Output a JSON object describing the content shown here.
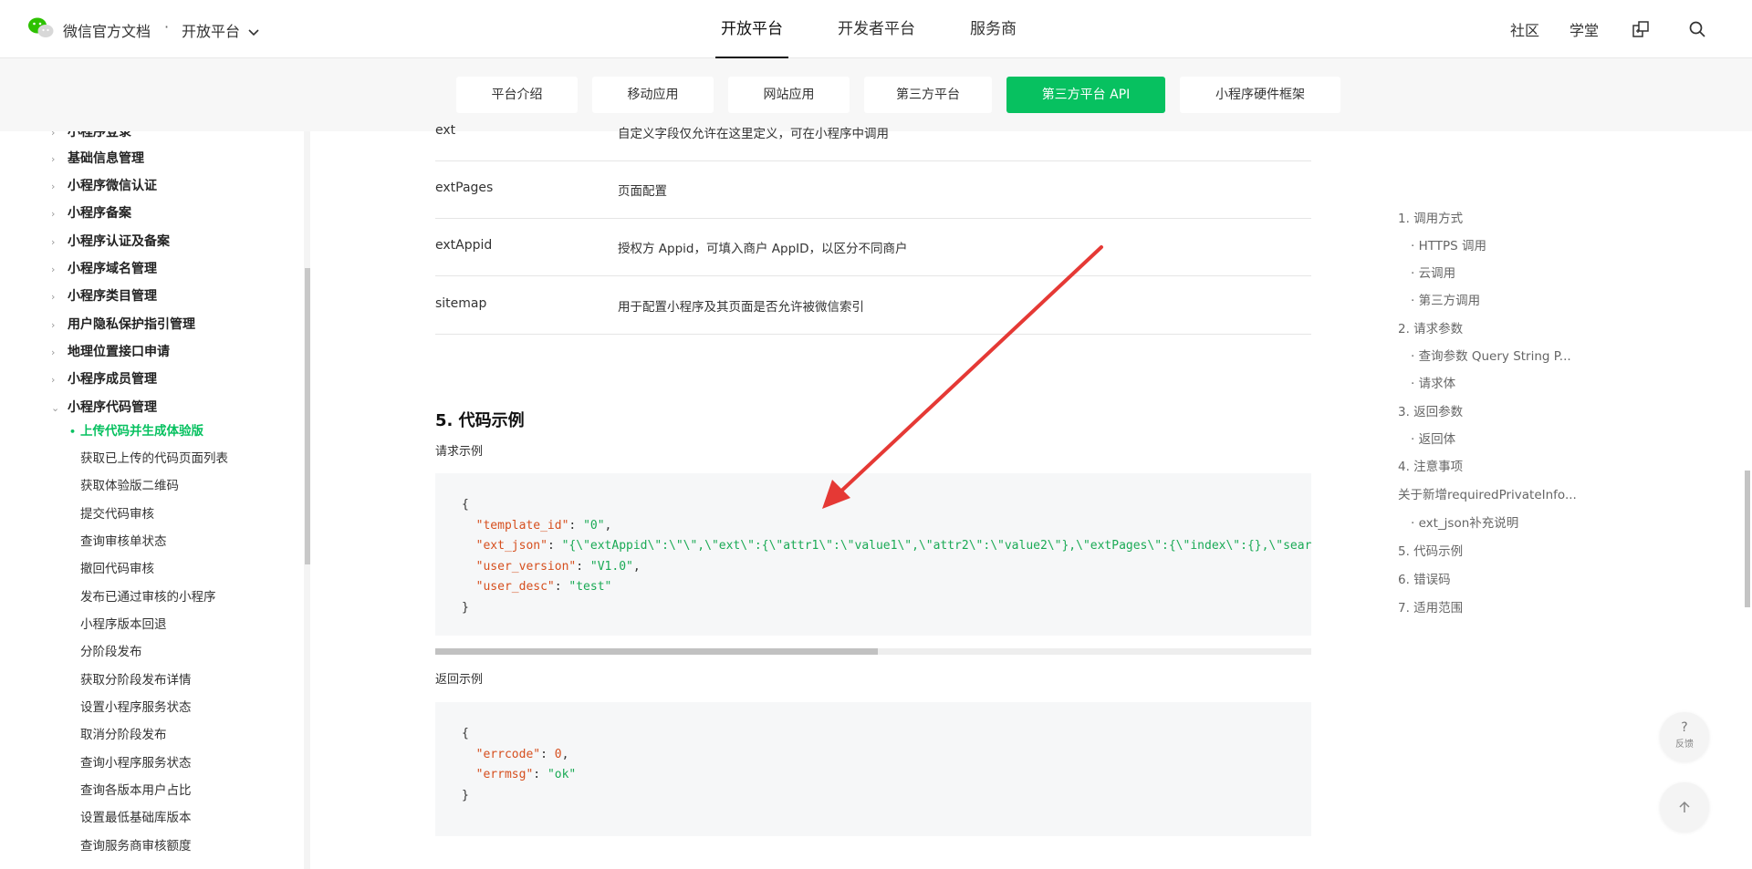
{
  "header": {
    "brand": "微信官方文档",
    "separator": "·",
    "platform": "开放平台",
    "main_nav": [
      "开放平台",
      "开发者平台",
      "服务商"
    ],
    "right_links": [
      "社区",
      "学堂"
    ]
  },
  "subnav": {
    "pills": [
      "平台介绍",
      "移动应用",
      "网站应用",
      "第三方平台",
      "第三方平台 API",
      "小程序硬件框架"
    ]
  },
  "sidebar": {
    "groups": [
      "小程序登录",
      "基础信息管理",
      "小程序微信认证",
      "小程序备案",
      "小程序认证及备案",
      "小程序域名管理",
      "小程序类目管理",
      "用户隐私保护指引管理",
      "地理位置接口申请",
      "小程序成员管理",
      "小程序代码管理"
    ],
    "active_item": "上传代码并生成体验版",
    "sub_items": [
      "获取已上传的代码页面列表",
      "获取体验版二维码",
      "提交代码审核",
      "查询审核单状态",
      "撤回代码审核",
      "发布已通过审核的小程序",
      "小程序版本回退",
      "分阶段发布",
      "获取分阶段发布详情",
      "设置小程序服务状态",
      "取消分阶段发布",
      "查询小程序服务状态",
      "查询各版本用户占比",
      "设置最低基础库版本",
      "查询服务商审核额度"
    ]
  },
  "params": [
    {
      "name": "ext",
      "desc": "自定义字段仅允许在这里定义，可在小程序中调用"
    },
    {
      "name": "extPages",
      "desc": "页面配置"
    },
    {
      "name": "extAppid",
      "desc": "授权方 Appid，可填入商户 AppID，以区分不同商户"
    },
    {
      "name": "sitemap",
      "desc": "用于配置小程序及其页面是否允许被微信索引"
    }
  ],
  "section": {
    "title": "5. 代码示例",
    "request_caption": "请求示例",
    "response_caption": "返回示例"
  },
  "request_code": {
    "open": "{",
    "k1": "\"template_id\"",
    "v1": "\"0\"",
    "k2": "\"ext_json\"",
    "v2": "\"{\\\"extAppid\\\":\\\"\\\",\\\"ext\\\":{\\\"attr1\\\":\\\"value1\\\",\\\"attr2\\\":\\\"value2\\\"},\\\"extPages\\\":{\\\"index\\\":{},\\\"search",
    "k3": "\"user_version\"",
    "v3": "\"V1.0\"",
    "k4": "\"user_desc\"",
    "v4": "\"test\"",
    "close": "}"
  },
  "response_code": {
    "open": "{",
    "k1": "\"errcode\"",
    "v1": "0",
    "k2": "\"errmsg\"",
    "v2": "\"ok\"",
    "close": "}"
  },
  "toc": [
    {
      "label": "1. 调用方式",
      "sub": false
    },
    {
      "label": "· HTTPS 调用",
      "sub": true
    },
    {
      "label": "· 云调用",
      "sub": true
    },
    {
      "label": "· 第三方调用",
      "sub": true
    },
    {
      "label": "2. 请求参数",
      "sub": false
    },
    {
      "label": "· 查询参数 Query String P...",
      "sub": true
    },
    {
      "label": "· 请求体",
      "sub": true
    },
    {
      "label": "3. 返回参数",
      "sub": false
    },
    {
      "label": "· 返回体",
      "sub": true
    },
    {
      "label": "4. 注意事项",
      "sub": false
    },
    {
      "label": "关于新增requiredPrivateInfo...",
      "sub": false
    },
    {
      "label": "· ext_json补充说明",
      "sub": true
    },
    {
      "label": "5. 代码示例",
      "sub": false
    },
    {
      "label": "6. 错误码",
      "sub": false
    },
    {
      "label": "7. 适用范围",
      "sub": false
    }
  ],
  "floating": {
    "feedback_symbol": "?",
    "feedback_label": "反馈"
  },
  "colors": {
    "accent": "#07c160",
    "code_key": "#d64f1e",
    "code_string": "#1aaa55",
    "annotation_arrow": "#e53935"
  },
  "icons": [
    "wechat-logo-icon",
    "chevron-down-icon",
    "switch-icon",
    "search-icon",
    "chevron-right-icon",
    "arrow-up-icon"
  ]
}
